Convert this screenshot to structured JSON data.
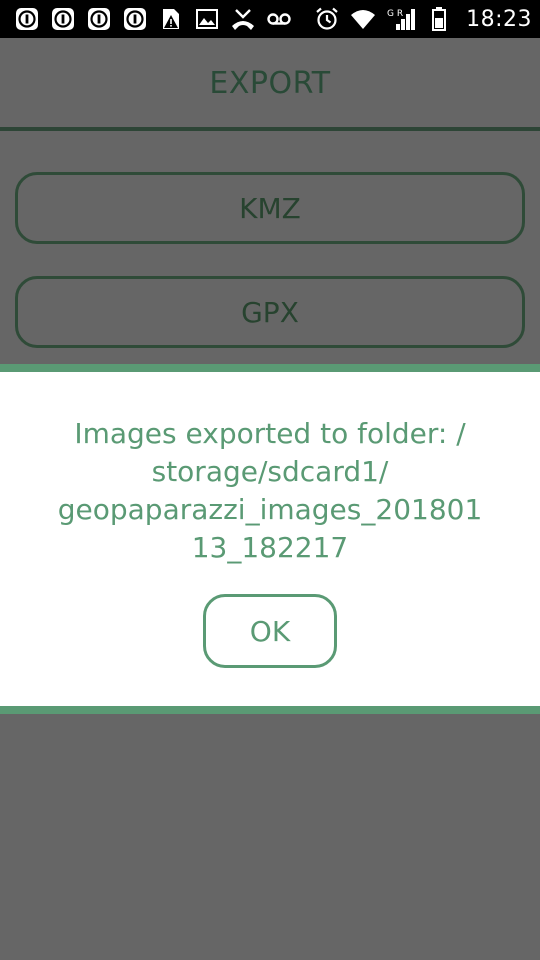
{
  "status_bar": {
    "time": "18:23",
    "network_label": "G R",
    "left_icons": [
      "app-notification-icon",
      "app-notification-icon",
      "app-notification-icon",
      "app-notification-icon",
      "sim-warning-icon",
      "image-icon",
      "missed-call-icon",
      "voicemail-icon"
    ],
    "right_icons": [
      "alarm-icon",
      "wifi-icon",
      "signal-icon",
      "battery-icon"
    ]
  },
  "screen": {
    "title": "EXPORT",
    "buttons": [
      {
        "label": "KMZ"
      },
      {
        "label": "GPX"
      }
    ]
  },
  "dialog": {
    "message_lines": [
      "Images exported to folder: /",
      "storage/sdcard1/",
      "geopaparazzi_images_201801",
      "13_182217"
    ],
    "ok_label": "OK"
  },
  "colors": {
    "status_bar_bg": "#000000",
    "dim_bg": "#666666",
    "accent_green": "#5a9a74",
    "dark_green": "#2f4b38",
    "dialog_bg": "#ffffff"
  }
}
